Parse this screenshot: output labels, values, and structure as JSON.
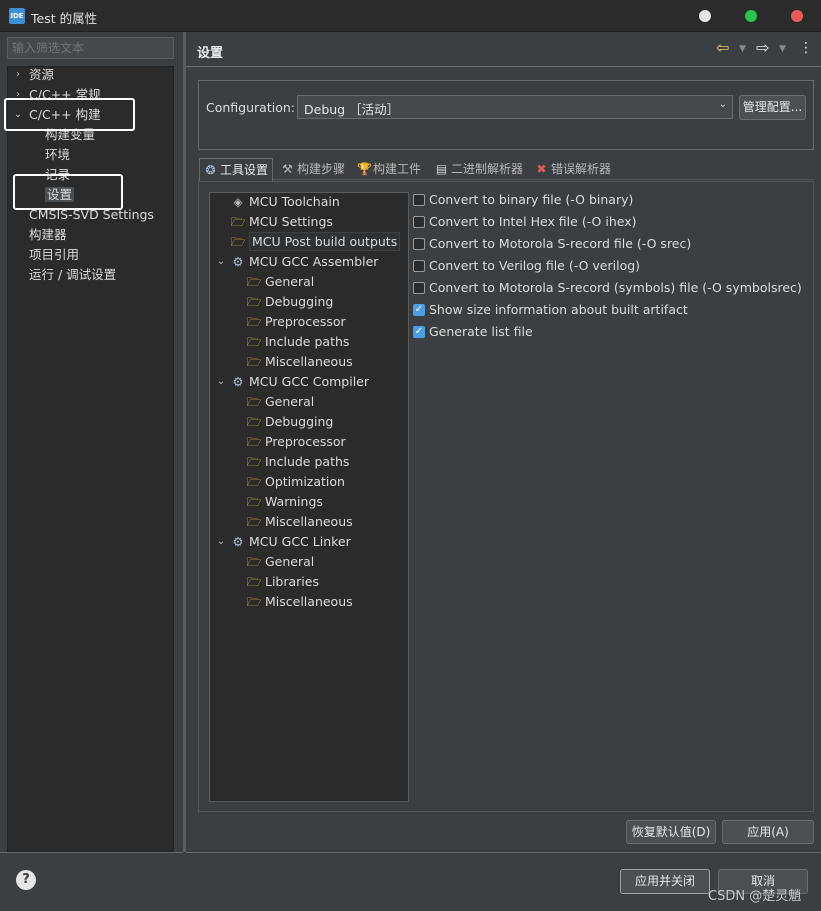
{
  "window": {
    "app_icon_text": "IDE",
    "title": "Test 的属性",
    "controls": [
      "minimize",
      "maximize",
      "close"
    ],
    "colors": {
      "minimize": "#e6e6e6",
      "maximize": "#29c44a",
      "close": "#ee5a58"
    }
  },
  "left": {
    "filter_placeholder": "输入筛选文本",
    "tree": [
      {
        "label": "资源",
        "chevron": "›"
      },
      {
        "label": "C/C++ 常规",
        "chevron": "›"
      },
      {
        "label": "C/C++ 构建",
        "chevron": "⌄"
      },
      {
        "label": "构建变量"
      },
      {
        "label": "环境"
      },
      {
        "label": "记录"
      },
      {
        "label": "设置"
      },
      {
        "label": "CMSIS-SVD Settings"
      },
      {
        "label": "构建器"
      },
      {
        "label": "项目引用"
      },
      {
        "label": "运行 / 调试设置"
      }
    ]
  },
  "header": {
    "title": "设置",
    "back_icon": "back-arrow-icon",
    "forward_icon": "forward-arrow-icon",
    "menu_icon": "⋮"
  },
  "config": {
    "label": "Configuration:",
    "value": "Debug ［活动］",
    "manage_button": "管理配置..."
  },
  "tabs": [
    {
      "label": "工具设置",
      "icon": "tool-settings-icon",
      "glyph": "❂"
    },
    {
      "label": "构建步骤",
      "icon": "build-steps-icon",
      "glyph": "⚒"
    },
    {
      "label": "构建工件",
      "icon": "build-artifact-icon",
      "glyph": "🏆"
    },
    {
      "label": "二进制解析器",
      "icon": "binary-parser-icon",
      "glyph": "▤"
    },
    {
      "label": "错误解析器",
      "icon": "error-parser-icon",
      "glyph": "✖"
    }
  ],
  "settings_tree": [
    {
      "label": "MCU Toolchain",
      "icon": "chip"
    },
    {
      "label": "MCU Settings",
      "icon": "folder"
    },
    {
      "label": "MCU Post build outputs",
      "icon": "folder"
    },
    {
      "label": "MCU GCC Assembler",
      "icon": "gear",
      "chevron": "⌄"
    },
    {
      "label": "General",
      "icon": "folder"
    },
    {
      "label": "Debugging",
      "icon": "folder"
    },
    {
      "label": "Preprocessor",
      "icon": "folder"
    },
    {
      "label": "Include paths",
      "icon": "folder"
    },
    {
      "label": "Miscellaneous",
      "icon": "folder"
    },
    {
      "label": "MCU GCC Compiler",
      "icon": "gear",
      "chevron": "⌄"
    },
    {
      "label": "General",
      "icon": "folder"
    },
    {
      "label": "Debugging",
      "icon": "folder"
    },
    {
      "label": "Preprocessor",
      "icon": "folder"
    },
    {
      "label": "Include paths",
      "icon": "folder"
    },
    {
      "label": "Optimization",
      "icon": "folder"
    },
    {
      "label": "Warnings",
      "icon": "folder"
    },
    {
      "label": "Miscellaneous",
      "icon": "folder"
    },
    {
      "label": "MCU GCC Linker",
      "icon": "gear",
      "chevron": "⌄"
    },
    {
      "label": "General",
      "icon": "folder"
    },
    {
      "label": "Libraries",
      "icon": "folder"
    },
    {
      "label": "Miscellaneous",
      "icon": "folder"
    }
  ],
  "options": [
    {
      "label": "Convert to binary file (-O binary)",
      "checked": false
    },
    {
      "label": "Convert to Intel Hex file (-O ihex)",
      "checked": false
    },
    {
      "label": "Convert to Motorola S-record file (-O srec)",
      "checked": false
    },
    {
      "label": "Convert to Verilog file (-O verilog)",
      "checked": false
    },
    {
      "label": "Convert to Motorola S-record (symbols) file (-O symbolsrec)",
      "checked": false
    },
    {
      "label": "Show size information about built artifact",
      "checked": true
    },
    {
      "label": "Generate list file",
      "checked": true
    }
  ],
  "buttons": {
    "restore_defaults": "恢复默认值(D)",
    "apply": "应用(A)",
    "apply_close": "应用并关闭",
    "cancel": "取消"
  },
  "footer": {
    "help": "?",
    "watermark": "CSDN @楚灵魈"
  }
}
